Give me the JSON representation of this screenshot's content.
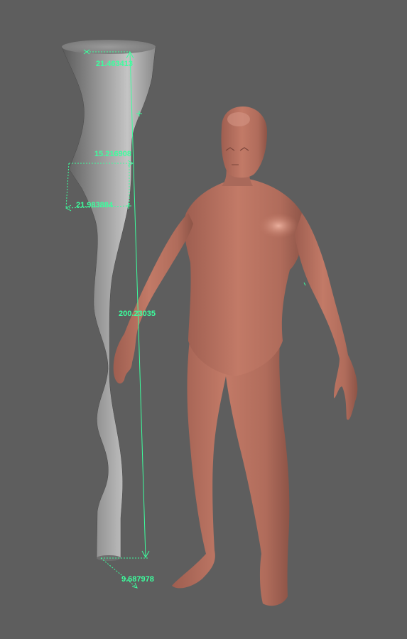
{
  "viewport": {
    "background": "#5e5e5e",
    "measure_color": "#3cff9e",
    "skin_color": "#b8705f"
  },
  "objects": [
    {
      "name": "curved-column-mesh"
    },
    {
      "name": "human-figure-mesh"
    }
  ],
  "measurements": {
    "top_width": "21.463413",
    "mid_width": "15.216908",
    "lower_width": "21.983884",
    "total_height": "200.23035",
    "base_width": "9.687978"
  }
}
